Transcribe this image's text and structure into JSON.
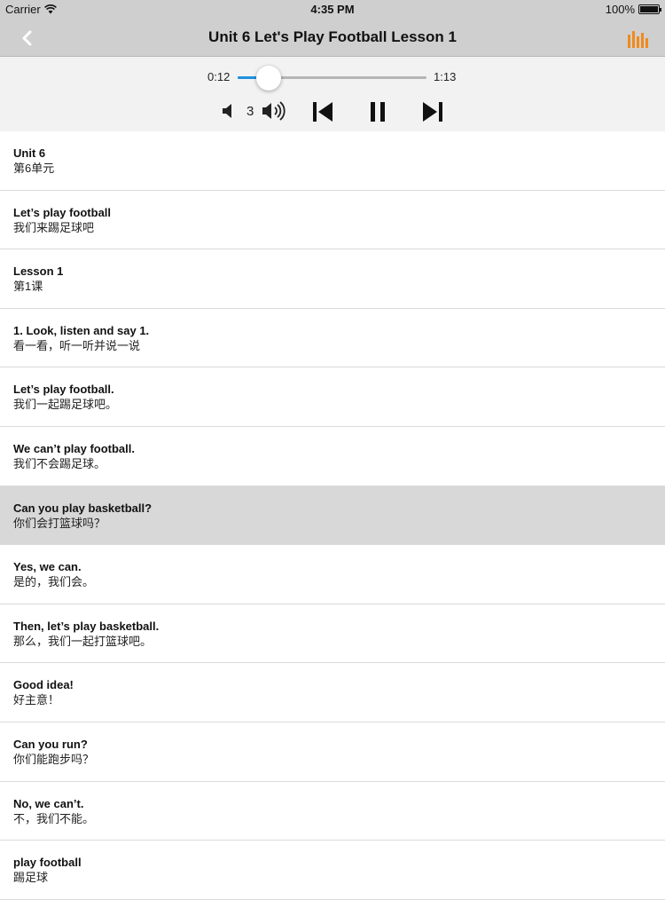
{
  "status_bar": {
    "carrier": "Carrier",
    "time": "4:35 PM",
    "battery": "100%",
    "battery_level": 1.0
  },
  "nav": {
    "title": "Unit 6 Let's Play Football Lesson 1",
    "back_icon": "chevron-left-icon",
    "menu_icon": "bars-chart-icon",
    "accent": "#f08a1c"
  },
  "player": {
    "current_time": "0:12",
    "total_time": "1:13",
    "progress": 0.164,
    "volume": "3",
    "progress_color": "#1e90e0"
  },
  "sentences": [
    {
      "en": "Unit 6",
      "zh": "第6单元",
      "active": false
    },
    {
      "en": "Let’s play football",
      "zh": "我们来踢足球吧",
      "active": false
    },
    {
      "en": "Lesson 1",
      "zh": "第1课",
      "active": false
    },
    {
      "en": "1. Look, listen and say 1.",
      "zh": "看一看，听一听并说一说",
      "active": false
    },
    {
      "en": "Let’s play football.",
      "zh": "我们一起踢足球吧。",
      "active": false
    },
    {
      "en": "We can’t play football.",
      "zh": "我们不会踢足球。",
      "active": false
    },
    {
      "en": "Can you play basketball?",
      "zh": "你们会打篮球吗？",
      "active": true
    },
    {
      "en": "Yes, we can.",
      "zh": "是的，我们会。",
      "active": false
    },
    {
      "en": "Then, let’s play basketball.",
      "zh": "那么，我们一起打篮球吧。",
      "active": false
    },
    {
      "en": "Good idea!",
      "zh": "好主意！",
      "active": false
    },
    {
      "en": "Can you run?",
      "zh": "你们能跑步吗？",
      "active": false
    },
    {
      "en": "No, we can’t.",
      "zh": "不，我们不能。",
      "active": false
    },
    {
      "en": "play football",
      "zh": "踢足球",
      "active": false
    }
  ]
}
